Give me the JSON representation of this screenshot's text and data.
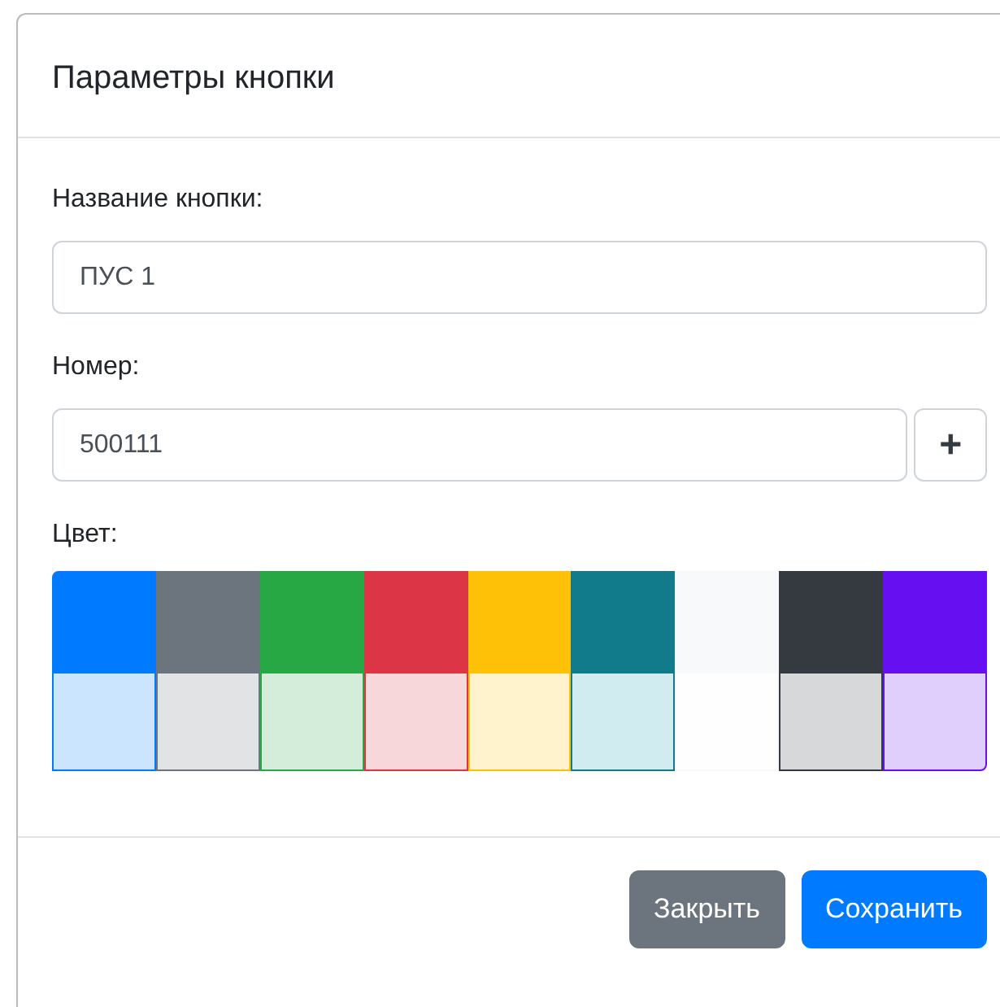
{
  "dialog": {
    "title": "Параметры кнопки",
    "fields": [
      {
        "kind": "text",
        "label": "Название кнопки:",
        "value": "ПУС 1"
      },
      {
        "kind": "number",
        "label": "Номер:",
        "value": "500111",
        "add_button": "+"
      }
    ],
    "color_label": "Цвет:",
    "swatch_rows": [
      {
        "swatches": [
          {
            "color": "#007bff"
          },
          {
            "color": "#6c757d"
          },
          {
            "color": "#28a745"
          },
          {
            "color": "#dc3545"
          },
          {
            "color": "#ffc107"
          },
          {
            "color": "#117a8b"
          },
          {
            "color": "#f8f9fa"
          },
          {
            "color": "#343a40"
          },
          {
            "color": "#6610f2"
          }
        ]
      },
      {
        "swatches": [
          {
            "color": "#cce5ff"
          },
          {
            "color": "#e2e3e5"
          },
          {
            "color": "#d4edda"
          },
          {
            "color": "#f8d7da"
          },
          {
            "color": "#fff3cd"
          },
          {
            "color": "#d1ecf1"
          },
          {
            "color": "#fefefe"
          },
          {
            "color": "#d6d8d9"
          },
          {
            "color": "#e0cffc"
          }
        ]
      }
    ],
    "buttons": [
      {
        "label": "Закрыть",
        "kind": "secondary"
      },
      {
        "label": "Сохранить",
        "kind": "primary"
      }
    ]
  }
}
